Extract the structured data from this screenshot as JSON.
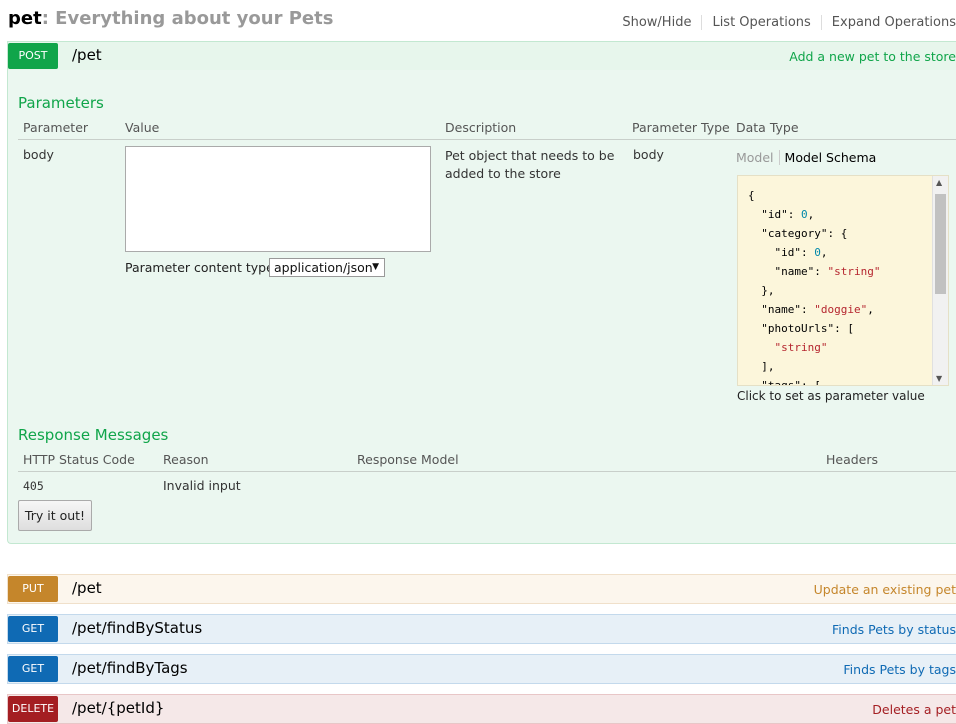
{
  "header": {
    "resource": "pet",
    "description": ": Everything about your Pets",
    "links": [
      "Show/Hide",
      "List Operations",
      "Expand Operations"
    ]
  },
  "post_op": {
    "method": "POST",
    "path": "/pet",
    "summary": "Add a new pet to the store",
    "parameters_title": "Parameters",
    "param_columns": [
      "Parameter",
      "Value",
      "Description",
      "Parameter Type",
      "Data Type"
    ],
    "param": {
      "name": "body",
      "value": "",
      "description_line1": "Pet object that needs to be",
      "description_line2": "added to the store",
      "type": "body"
    },
    "content_type_label": "Parameter content type:",
    "content_type_value": "application/json",
    "model_tabs": {
      "model": "Model",
      "schema": "Model Schema"
    },
    "click_hint": "Click to set as parameter value",
    "responses_title": "Response Messages",
    "response_columns": [
      "HTTP Status Code",
      "Reason",
      "Response Model",
      "Headers"
    ],
    "response": {
      "code": "405",
      "reason": "Invalid input"
    },
    "try_button": "Try it out!"
  },
  "operations": [
    {
      "method": "PUT",
      "path": "/pet",
      "summary": "Update an existing pet"
    },
    {
      "method": "GET",
      "path": "/pet/findByStatus",
      "summary": "Finds Pets by status"
    },
    {
      "method": "GET",
      "path": "/pet/findByTags",
      "summary": "Finds Pets by tags"
    },
    {
      "method": "DELETE",
      "path": "/pet/{petId}",
      "summary": "Deletes a pet"
    }
  ],
  "colors": {
    "post": "#10a54a",
    "put": "#c5862b",
    "get": "#0f6ab4",
    "delete": "#a41e22"
  },
  "icons": {
    "dropdown": "chevron-down-icon",
    "scroll_up": "arrow-up-icon",
    "scroll_down": "arrow-down-icon"
  }
}
